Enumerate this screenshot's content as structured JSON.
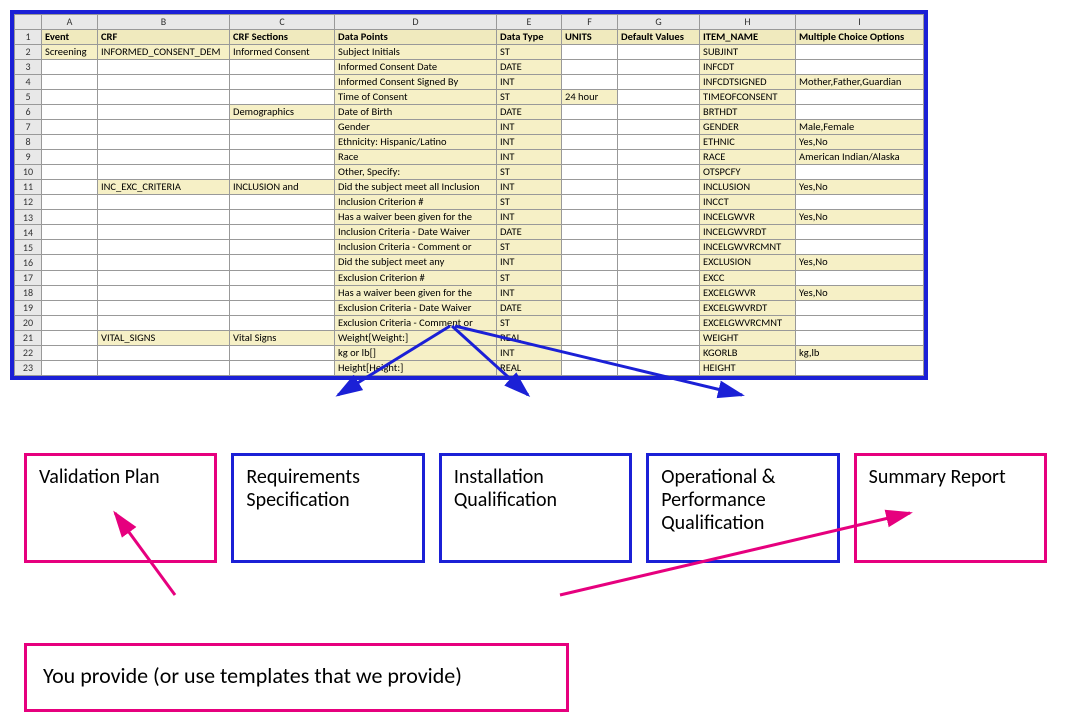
{
  "columns": [
    "",
    "A",
    "B",
    "C",
    "D",
    "E",
    "F",
    "G",
    "H",
    "I"
  ],
  "header": [
    "Event",
    "CRF",
    "CRF Sections",
    "Data Points",
    "Data Type",
    "UNITS",
    "Default Values",
    "ITEM_NAME",
    "Multiple Choice Options"
  ],
  "rows": [
    {
      "n": 2,
      "cells": [
        "Screening",
        "INFORMED_CONSENT_DEM",
        "Informed Consent",
        "Subject Initials",
        "ST",
        "",
        "",
        "SUBJINT",
        ""
      ],
      "yA": true,
      "yB": true,
      "yC": true,
      "yD": true,
      "yE": true,
      "yH": true
    },
    {
      "n": 3,
      "cells": [
        "",
        "",
        "",
        "Informed Consent Date",
        "DATE",
        "",
        "",
        "INFCDT",
        ""
      ],
      "yD": true,
      "yE": true,
      "yH": true
    },
    {
      "n": 4,
      "cells": [
        "",
        "",
        "",
        "Informed Consent Signed By",
        "INT",
        "",
        "",
        "INFCDTSIGNED",
        "Mother,Father,Guardian"
      ],
      "yD": true,
      "yE": true,
      "yH": true,
      "yI": true
    },
    {
      "n": 5,
      "cells": [
        "",
        "",
        "",
        "Time of Consent",
        "ST",
        "24 hour",
        "",
        "TIMEOFCONSENT",
        ""
      ],
      "yD": true,
      "yE": true,
      "yF": true,
      "yH": true
    },
    {
      "n": 6,
      "cells": [
        "",
        "",
        "Demographics",
        "Date of Birth",
        "DATE",
        "",
        "",
        "BRTHDT",
        ""
      ],
      "yC": true,
      "yD": true,
      "yE": true,
      "yH": true
    },
    {
      "n": 7,
      "cells": [
        "",
        "",
        "",
        "Gender",
        "INT",
        "",
        "",
        "GENDER",
        "Male,Female"
      ],
      "yD": true,
      "yE": true,
      "yH": true,
      "yI": true
    },
    {
      "n": 8,
      "cells": [
        "",
        "",
        "",
        "Ethnicity: Hispanic/Latino",
        "INT",
        "",
        "",
        "ETHNIC",
        "Yes,No"
      ],
      "yD": true,
      "yE": true,
      "yH": true,
      "yI": true
    },
    {
      "n": 9,
      "cells": [
        "",
        "",
        "",
        "Race",
        "INT",
        "",
        "",
        "RACE",
        "American Indian/Alaska"
      ],
      "yD": true,
      "yE": true,
      "yH": true,
      "yI": true
    },
    {
      "n": 10,
      "cells": [
        "",
        "",
        "",
        "Other, Specify:",
        "ST",
        "",
        "",
        "OTSPCFY",
        ""
      ],
      "yD": true,
      "yE": true,
      "yH": true
    },
    {
      "n": 11,
      "cells": [
        "",
        "INC_EXC_CRITERIA",
        "INCLUSION and",
        "Did the subject meet all Inclusion",
        "INT",
        "",
        "",
        "INCLUSION",
        "Yes,No"
      ],
      "yB": true,
      "yC": true,
      "yD": true,
      "yE": true,
      "yH": true,
      "yI": true
    },
    {
      "n": 12,
      "cells": [
        "",
        "",
        "",
        "Inclusion Criterion #",
        "ST",
        "",
        "",
        "INCCT",
        ""
      ],
      "yD": true,
      "yE": true,
      "yH": true
    },
    {
      "n": 13,
      "cells": [
        "",
        "",
        "",
        "Has a waiver been given for the",
        "INT",
        "",
        "",
        "INCELGWVR",
        "Yes,No"
      ],
      "yD": true,
      "yE": true,
      "yH": true,
      "yI": true
    },
    {
      "n": 14,
      "cells": [
        "",
        "",
        "",
        "Inclusion Criteria - Date Waiver",
        "DATE",
        "",
        "",
        "INCELGWVRDT",
        ""
      ],
      "yD": true,
      "yE": true,
      "yH": true
    },
    {
      "n": 15,
      "cells": [
        "",
        "",
        "",
        "Inclusion Criteria - Comment or",
        "ST",
        "",
        "",
        "INCELGWVRCMNT",
        ""
      ],
      "yD": true,
      "yE": true,
      "yH": true
    },
    {
      "n": 16,
      "cells": [
        "",
        "",
        "",
        "Did the subject meet any",
        "INT",
        "",
        "",
        "EXCLUSION",
        "Yes,No"
      ],
      "yD": true,
      "yE": true,
      "yH": true,
      "yI": true
    },
    {
      "n": 17,
      "cells": [
        "",
        "",
        "",
        "Exclusion Criterion #",
        "ST",
        "",
        "",
        "EXCC",
        ""
      ],
      "yD": true,
      "yE": true,
      "yH": true
    },
    {
      "n": 18,
      "cells": [
        "",
        "",
        "",
        "Has a waiver been given for the",
        "INT",
        "",
        "",
        "EXCELGWVR",
        "Yes,No"
      ],
      "yD": true,
      "yE": true,
      "yH": true,
      "yI": true
    },
    {
      "n": 19,
      "cells": [
        "",
        "",
        "",
        "Exclusion Criteria - Date Waiver",
        "DATE",
        "",
        "",
        "EXCELGWVRDT",
        ""
      ],
      "yD": true,
      "yE": true,
      "yH": true
    },
    {
      "n": 20,
      "cells": [
        "",
        "",
        "",
        "Exclusion Criteria - Comment or",
        "ST",
        "",
        "",
        "EXCELGWVRCMNT",
        ""
      ],
      "yD": true,
      "yE": true,
      "yH": true
    },
    {
      "n": 21,
      "cells": [
        "",
        "VITAL_SIGNS",
        "Vital Signs",
        "Weight[Weight:]",
        "REAL",
        "",
        "",
        "WEIGHT",
        ""
      ],
      "yB": true,
      "yC": true,
      "yD": true,
      "yE": true,
      "yH": true
    },
    {
      "n": 22,
      "cells": [
        "",
        "",
        "",
        "kg or lb[]",
        "INT",
        "",
        "",
        "KGORLB",
        "kg,lb"
      ],
      "yD": true,
      "yE": true,
      "yH": true,
      "yI": true
    },
    {
      "n": 23,
      "cells": [
        "",
        "",
        "",
        "Height[Height:]",
        "REAL",
        "",
        "",
        "HEIGHT",
        ""
      ],
      "yD": true,
      "yE": true,
      "yH": true
    }
  ],
  "boxes": {
    "validation": "Validation Plan",
    "requirements": "Requirements Specification",
    "installation": "Installation Qualification",
    "operational": "Operational & Performance Qualification",
    "summary": "Summary Report"
  },
  "lower": "You provide (or use templates that we provide)"
}
